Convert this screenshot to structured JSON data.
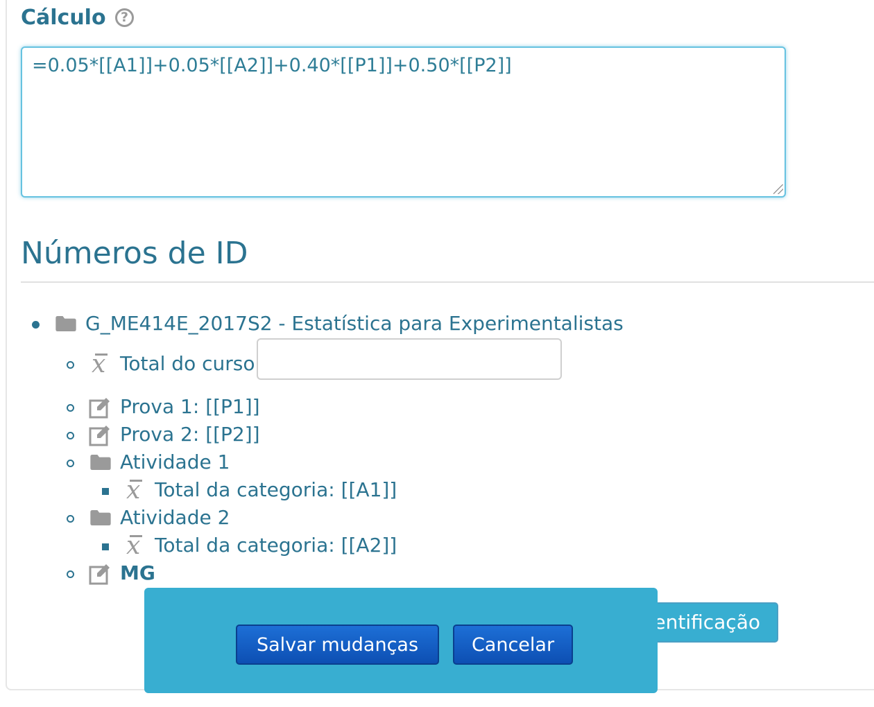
{
  "calculation": {
    "label": "Cálculo",
    "help_icon": "?",
    "formula": "=0.05*[[A1]]+0.05*[[A2]]+0.40*[[P1]]+0.50*[[P2]]"
  },
  "id_numbers": {
    "title": "Números de ID",
    "tree": {
      "course": "G_ME414E_2017S2 - Estatística para Experimentalistas",
      "course_total_label": "Total do curso",
      "course_total_value": "",
      "items": {
        "prova1": "Prova 1: [[P1]]",
        "prova2": "Prova 2: [[P2]]",
        "atividade1": "Atividade 1",
        "atividade1_total": "Total da categoria: [[A1]]",
        "atividade2": "Atividade 2",
        "atividade2_total": "Total da categoria: [[A2]]",
        "mg": "MG"
      }
    }
  },
  "buttons": {
    "partially_hidden": "entificação",
    "save": "Salvar mudanças",
    "cancel": "Cancelar"
  },
  "icons": {
    "xbar_glyph": "x"
  },
  "colors": {
    "text": "#2b7390",
    "sticky_bar": "#38aed1",
    "button": "#1d6fd6",
    "icon_gray": "#9a9a9a"
  }
}
